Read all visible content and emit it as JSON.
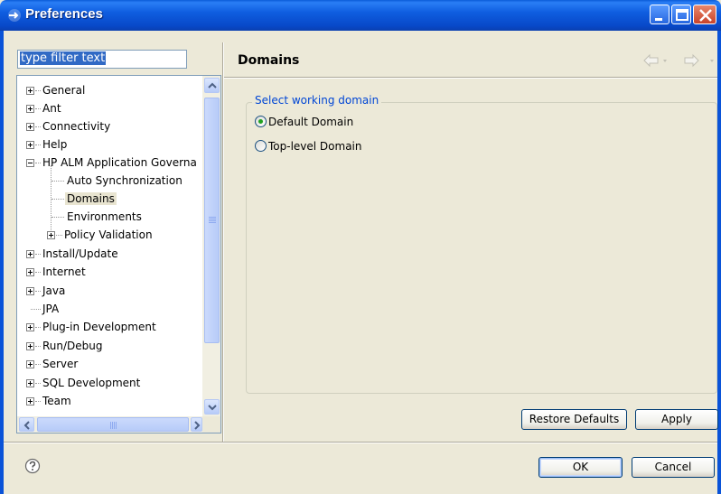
{
  "window": {
    "title": "Preferences"
  },
  "filter": {
    "value": "type filter text"
  },
  "tree": {
    "items": [
      {
        "label": "General",
        "expander": "plus"
      },
      {
        "label": "Ant",
        "expander": "plus"
      },
      {
        "label": "Connectivity",
        "expander": "plus"
      },
      {
        "label": "Help",
        "expander": "plus"
      },
      {
        "label": "HP ALM Application Governa",
        "expander": "minus"
      },
      {
        "label": "Auto Synchronization",
        "expander": "none"
      },
      {
        "label": "Domains",
        "expander": "none",
        "selected": true
      },
      {
        "label": "Environments",
        "expander": "none"
      },
      {
        "label": "Policy Validation",
        "expander": "plus"
      },
      {
        "label": "Install/Update",
        "expander": "plus"
      },
      {
        "label": "Internet",
        "expander": "plus"
      },
      {
        "label": "Java",
        "expander": "plus"
      },
      {
        "label": "JPA",
        "expander": "none"
      },
      {
        "label": "Plug-in Development",
        "expander": "plus"
      },
      {
        "label": "Run/Debug",
        "expander": "plus"
      },
      {
        "label": "Server",
        "expander": "plus"
      },
      {
        "label": "SQL Development",
        "expander": "plus"
      },
      {
        "label": "Team",
        "expander": "plus"
      }
    ]
  },
  "page": {
    "title": "Domains",
    "group_label": "Select working domain",
    "options": [
      {
        "label": "Default Domain",
        "checked": true
      },
      {
        "label": "Top-level Domain",
        "checked": false
      }
    ],
    "restore_defaults": "Restore Defaults",
    "apply": "Apply"
  },
  "footer": {
    "ok": "OK",
    "cancel": "Cancel"
  },
  "icons": {
    "app": "preferences-icon",
    "help": "help-icon",
    "back": "back-arrow-icon",
    "forward": "forward-arrow-icon"
  },
  "colors": {
    "titlebar": "#0a53d8",
    "group_label": "#0046d5",
    "selection": "#316ac5",
    "radio_dot": "#21a121"
  }
}
